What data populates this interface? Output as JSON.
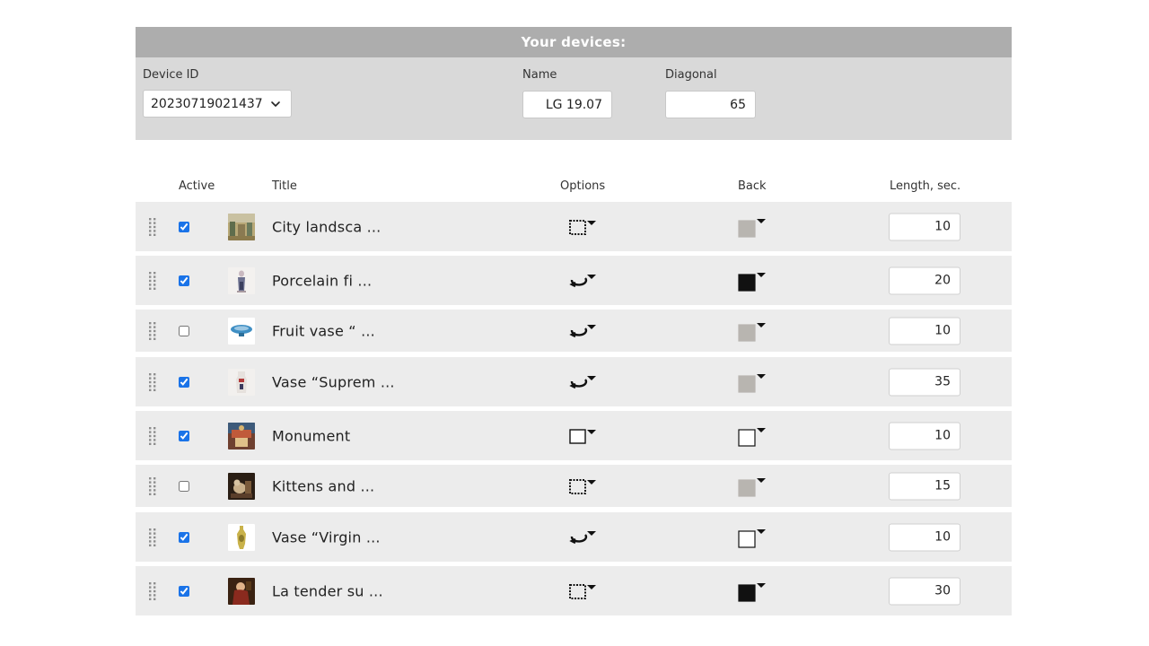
{
  "devices": {
    "header": "Your devices:",
    "device_id": {
      "label": "Device ID",
      "value": "20230719021437"
    },
    "name": {
      "label": "Name",
      "value": "LG 19.07"
    },
    "diagonal": {
      "label": "Diagonal",
      "value": "65"
    }
  },
  "table": {
    "headers": {
      "active": "Active",
      "title": "Title",
      "options": "Options",
      "back": "Back",
      "length": "Length, sec."
    },
    "rows": [
      {
        "active": true,
        "title": "City landsca ...",
        "option": "frame-dotted-icon",
        "back": "gray",
        "length": "10"
      },
      {
        "active": true,
        "title": "Porcelain fi ...",
        "option": "rotate-icon",
        "back": "black",
        "length": "20"
      },
      {
        "active": false,
        "title": "Fruit vase “ ...",
        "option": "rotate-icon",
        "back": "gray",
        "length": "10"
      },
      {
        "active": true,
        "title": "Vase “Suprem ...",
        "option": "rotate-icon",
        "back": "gray",
        "length": "35"
      },
      {
        "active": true,
        "title": "Monument",
        "option": "frame-plain-icon",
        "back": "white",
        "length": "10"
      },
      {
        "active": false,
        "title": "Kittens and ...",
        "option": "frame-dotted-icon",
        "back": "gray",
        "length": "15"
      },
      {
        "active": true,
        "title": "Vase “Virgin ...",
        "option": "rotate-icon",
        "back": "white",
        "length": "10"
      },
      {
        "active": true,
        "title": "La tender su ...",
        "option": "frame-dotted-icon",
        "back": "black",
        "length": "30"
      }
    ]
  },
  "colors": {
    "header_bg": "#adadad",
    "panel_bg": "#d9d9d9",
    "row_bg": "#ececec",
    "checkbox": "#1a73e8",
    "swatch_gray": "#b8b5b0",
    "swatch_black": "#111111",
    "swatch_white": "#ffffff"
  }
}
